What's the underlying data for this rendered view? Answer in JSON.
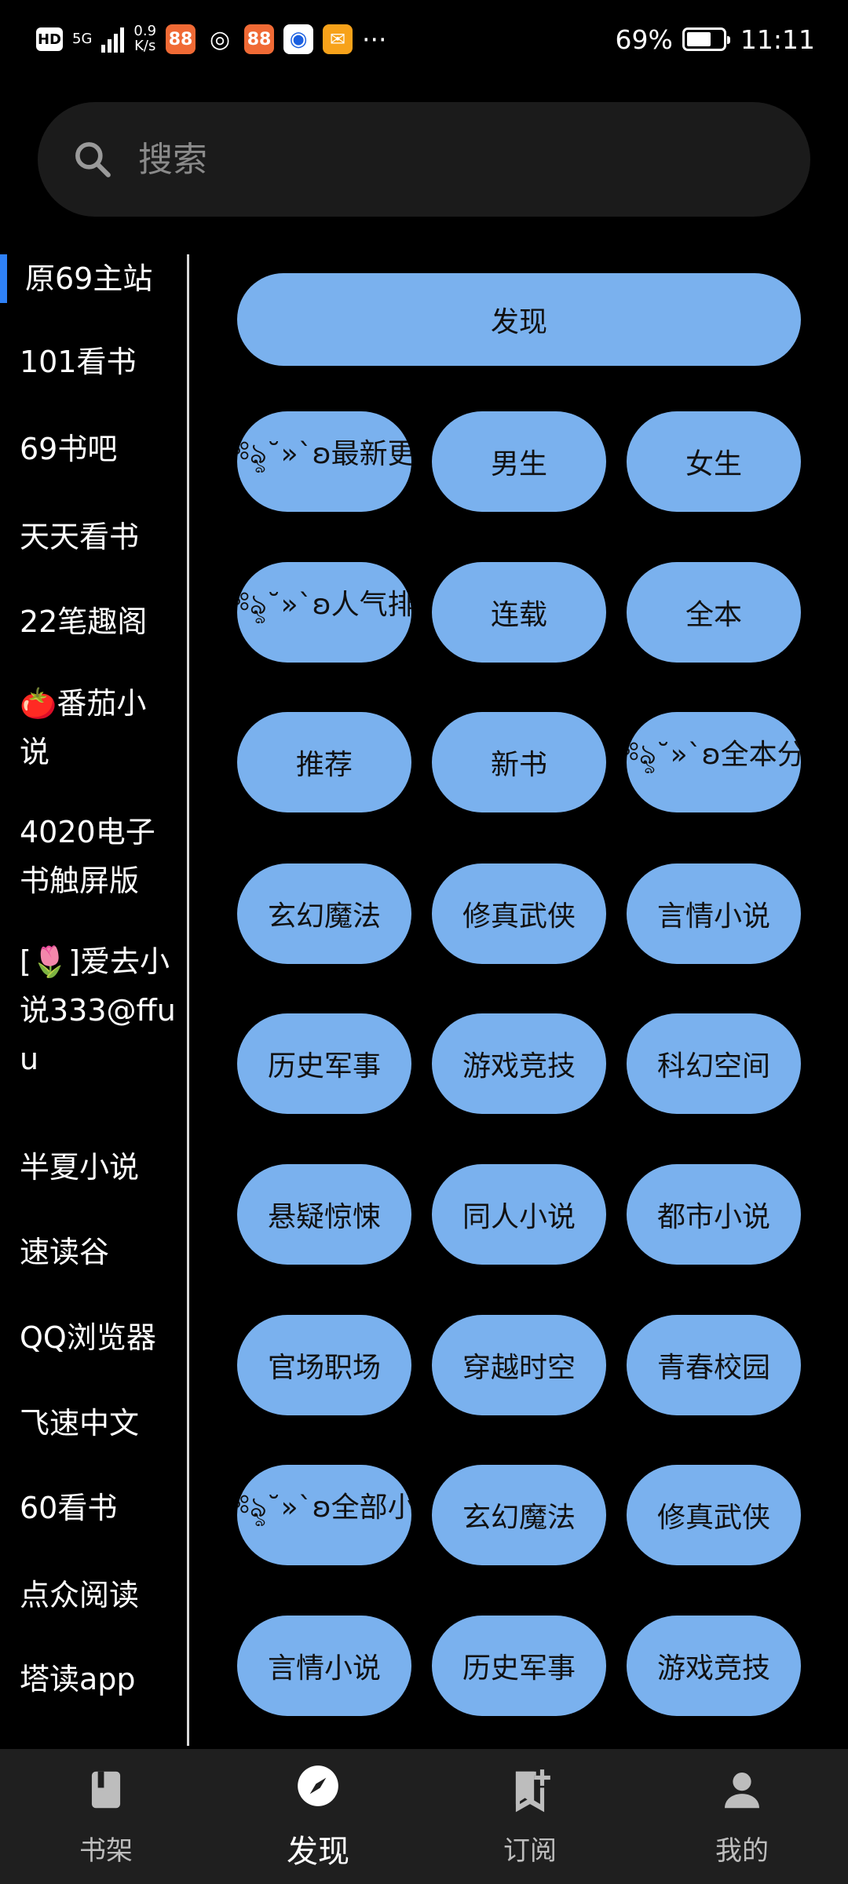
{
  "status_bar": {
    "hd": "HD",
    "net_type": "5G",
    "speed_value": "0.9",
    "speed_unit": "K/s",
    "more": "···",
    "battery": "69%",
    "time": "11:11",
    "battery_level": 0.69
  },
  "search": {
    "placeholder": "搜索"
  },
  "sidebar": {
    "items": [
      "原69主站",
      "101看书",
      "69书吧",
      "天天看书",
      "22笔趣阁",
      "🍅番茄小说",
      "4020电子书触屏版",
      "[🌷]爱去小说333@ffuu",
      "半夏小说",
      "速读谷",
      "QQ浏览器",
      "飞速中文",
      "60看书",
      "点众阅读",
      "塔读app"
    ],
    "active_index": 0
  },
  "content": {
    "wide_button": "发现",
    "rows": [
      [
        "༺ৡ˘»`ʚ最新更新",
        "男生",
        "女生"
      ],
      [
        "༺ৡ˘»`ʚ人气排行",
        "连载",
        "全本"
      ],
      [
        "推荐",
        "新书",
        "༺ৡ˘»`ʚ全本分类"
      ],
      [
        "玄幻魔法",
        "修真武侠",
        "言情小说"
      ],
      [
        "历史军事",
        "游戏竞技",
        "科幻空间"
      ],
      [
        "悬疑惊悚",
        "同人小说",
        "都市小说"
      ],
      [
        "官场职场",
        "穿越时空",
        "青春校园"
      ],
      [
        "༺ৡ˘»`ʚ全部小说",
        "玄幻魔法",
        "修真武侠"
      ],
      [
        "言情小说",
        "历史军事",
        "游戏竞技"
      ]
    ]
  },
  "bottom_nav": {
    "items": [
      {
        "label": "书架",
        "icon": "book-icon"
      },
      {
        "label": "发现",
        "icon": "compass-icon"
      },
      {
        "label": "订阅",
        "icon": "bookmark-add-icon"
      },
      {
        "label": "我的",
        "icon": "person-icon"
      }
    ],
    "active_index": 1
  },
  "colors": {
    "accent": "#2f81f7",
    "button_bg": "#7ab1ee",
    "background": "#000000",
    "nav_bg": "#1f1f1f"
  }
}
